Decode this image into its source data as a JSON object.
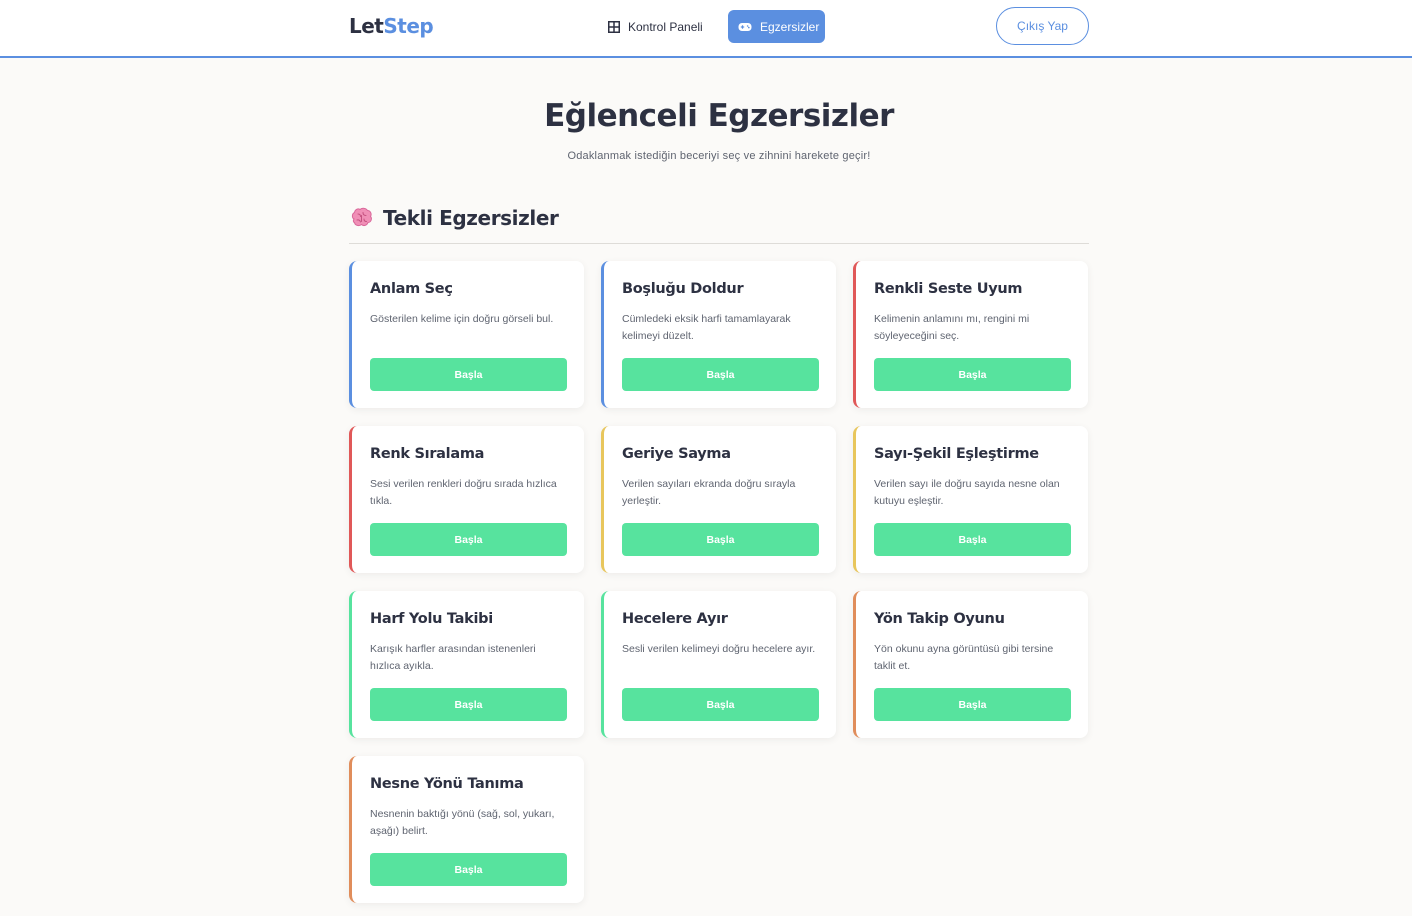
{
  "header": {
    "logo_part1": "Let",
    "logo_part2": "Step",
    "nav": [
      {
        "label": "Kontrol Paneli",
        "icon": "grid-icon"
      },
      {
        "label": "Egzersizler",
        "icon": "gamepad-icon",
        "active": true
      }
    ],
    "logout_label": "Çıkış Yap"
  },
  "page": {
    "title": "Eğlenceli Egzersizler",
    "subtitle": "Odaklanmak istediğin beceriyi seç ve zihnini harekete geçir!"
  },
  "section": {
    "icon": "brain-icon",
    "title": "Tekli Egzersizler"
  },
  "colors": {
    "accent": "#5b8fe0",
    "button": "#57e39e",
    "red": "#e05858",
    "yellow": "#e8c65c",
    "green": "#57e39e",
    "orange": "#e08d5b"
  },
  "exercises": [
    {
      "title": "Anlam Seç",
      "desc": "Gösterilen kelime için doğru görseli bul.",
      "button": "Başla",
      "color": "blue"
    },
    {
      "title": "Boşluğu Doldur",
      "desc": "Cümledeki eksik harfi tamamlayarak kelimeyi düzelt.",
      "button": "Başla",
      "color": "blue"
    },
    {
      "title": "Renkli Seste Uyum",
      "desc": "Kelimenin anlamını mı, rengini mi söyleyeceğini seç.",
      "button": "Başla",
      "color": "red"
    },
    {
      "title": "Renk Sıralama",
      "desc": "Sesi verilen renkleri doğru sırada hızlıca tıkla.",
      "button": "Başla",
      "color": "red"
    },
    {
      "title": "Geriye Sayma",
      "desc": "Verilen sayıları ekranda doğru sırayla yerleştir.",
      "button": "Başla",
      "color": "yellow"
    },
    {
      "title": "Sayı-Şekil Eşleştirme",
      "desc": "Verilen sayı ile doğru sayıda nesne olan kutuyu eşleştir.",
      "button": "Başla",
      "color": "yellow"
    },
    {
      "title": "Harf Yolu Takibi",
      "desc": "Karışık harfler arasından istenenleri hızlıca ayıkla.",
      "button": "Başla",
      "color": "green"
    },
    {
      "title": "Hecelere Ayır",
      "desc": "Sesli verilen kelimeyi doğru hecelere ayır.",
      "button": "Başla",
      "color": "green"
    },
    {
      "title": "Yön Takip Oyunu",
      "desc": "Yön okunu ayna görüntüsü gibi tersine taklit et.",
      "button": "Başla",
      "color": "orange"
    },
    {
      "title": "Nesne Yönü Tanıma",
      "desc": "Nesnenin baktığı yönü (sağ, sol, yukarı, aşağı) belirt.",
      "button": "Başla",
      "color": "orange"
    }
  ]
}
